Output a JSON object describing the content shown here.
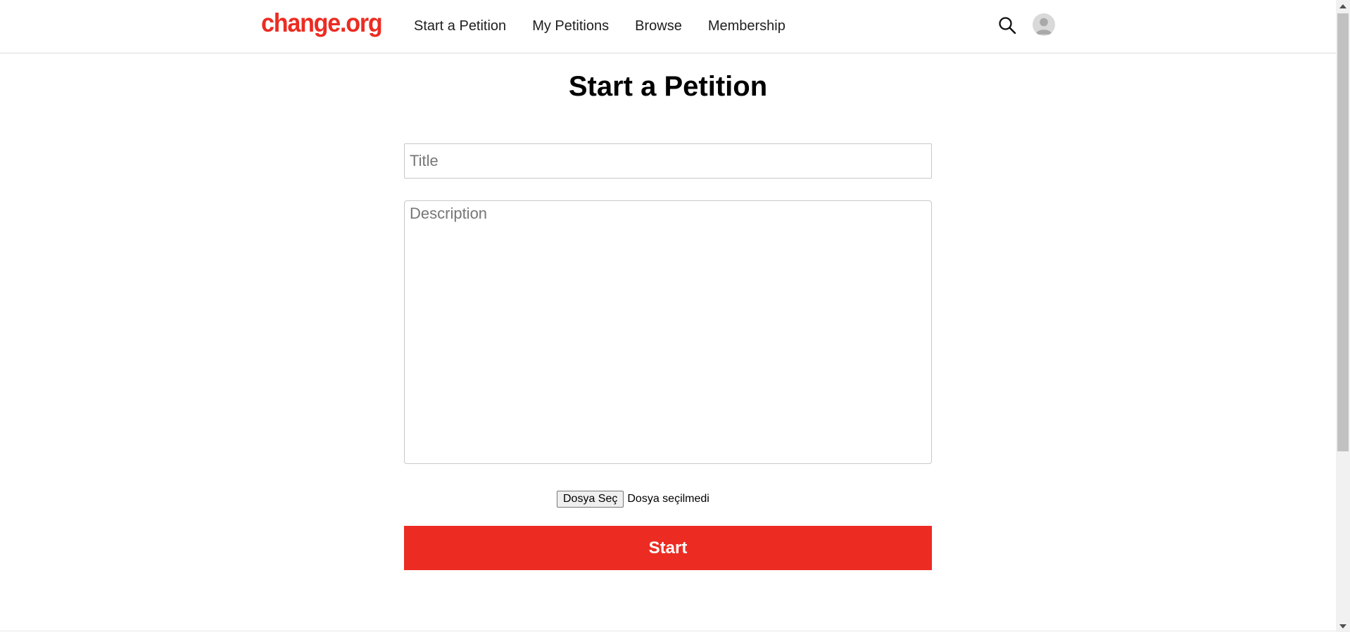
{
  "header": {
    "logo_text": "change.org",
    "nav": [
      {
        "label": "Start a Petition"
      },
      {
        "label": "My Petitions"
      },
      {
        "label": "Browse"
      },
      {
        "label": "Membership"
      }
    ],
    "search_icon": "search-icon",
    "avatar_icon": "user-avatar-icon"
  },
  "main": {
    "page_title": "Start a Petition",
    "title_field": {
      "value": "",
      "placeholder": "Title"
    },
    "description_field": {
      "value": "",
      "placeholder": "Description"
    },
    "file_upload": {
      "button_label": "Dosya Seç",
      "status": "Dosya seçilmedi"
    },
    "start_button_label": "Start"
  },
  "colors": {
    "brand": "#ec2c22",
    "text": "#1e1e1e",
    "border": "#c8c8c8",
    "placeholder": "#777777"
  }
}
